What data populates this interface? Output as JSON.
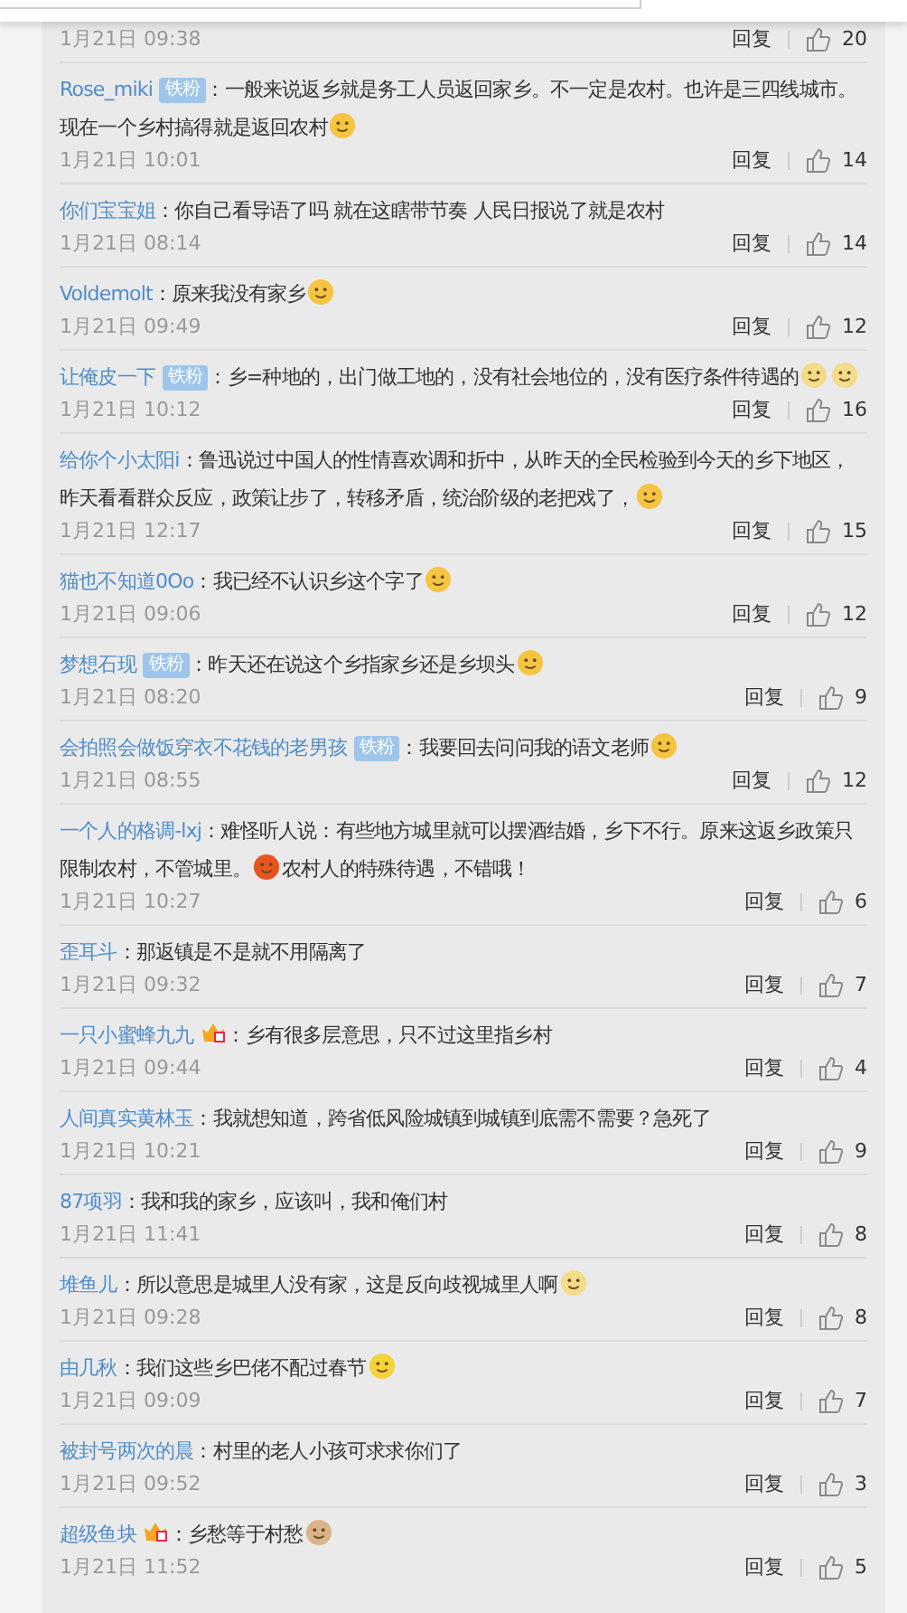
{
  "comments": [
    {
      "date": "1月21日 09:38",
      "reply": "回复",
      "likes": "20"
    },
    {
      "user": "Rose_miki",
      "badge": "铁粉",
      "content": [
        {
          "kind": "text",
          "text": "：一般来说返乡就是务工人员返回家乡。不一定是农村。也许是三四线城市。现在一个乡村搞得就是返回农村"
        },
        {
          "kind": "emoji",
          "color": "#f5c542"
        }
      ],
      "date": "1月21日 10:01",
      "reply": "回复",
      "likes": "14"
    },
    {
      "user": "你们宝宝姐",
      "content": [
        {
          "kind": "text",
          "text": "：你自己看导语了吗 就在这瞎带节奏 人民日报说了就是农村"
        }
      ],
      "date": "1月21日 08:14",
      "reply": "回复",
      "likes": "14"
    },
    {
      "user": "Voldemolt",
      "content": [
        {
          "kind": "text",
          "text": "：原来我没有家乡"
        },
        {
          "kind": "emoji",
          "color": "#f5c542"
        }
      ],
      "date": "1月21日 09:49",
      "reply": "回复",
      "likes": "12"
    },
    {
      "user": "让俺皮一下",
      "badge": "铁粉",
      "content": [
        {
          "kind": "text",
          "text": "：乡=种地的，出门做工地的，没有社会地位的，没有医疗条件待遇的"
        },
        {
          "kind": "emoji",
          "color": "#f3dc8a"
        },
        {
          "kind": "emoji",
          "color": "#f3dc8a"
        }
      ],
      "date": "1月21日 10:12",
      "reply": "回复",
      "likes": "16"
    },
    {
      "user": "给你个小太阳i",
      "content": [
        {
          "kind": "text",
          "text": "：鲁迅说过中国人的性情喜欢调和折中，从昨天的全民检验到今天的乡下地区，昨天看看群众反应，政策让步了，转移矛盾，统治阶级的老把戏了，"
        },
        {
          "kind": "emoji",
          "color": "#f5c542"
        }
      ],
      "date": "1月21日 12:17",
      "reply": "回复",
      "likes": "15"
    },
    {
      "user": "猫也不知道0Oo",
      "content": [
        {
          "kind": "text",
          "text": "：我已经不认识乡这个字了"
        },
        {
          "kind": "emoji",
          "color": "#f5c542"
        }
      ],
      "date": "1月21日 09:06",
      "reply": "回复",
      "likes": "12"
    },
    {
      "user": "梦想石现",
      "badge": "铁粉",
      "content": [
        {
          "kind": "text",
          "text": "：昨天还在说这个乡指家乡还是乡坝头"
        },
        {
          "kind": "emoji",
          "color": "#f5c542"
        }
      ],
      "date": "1月21日 08:20",
      "reply": "回复",
      "likes": "9"
    },
    {
      "user": "会拍照会做饭穿衣不花钱的老男孩",
      "badge": "铁粉",
      "content": [
        {
          "kind": "text",
          "text": "：我要回去问问我的语文老师"
        },
        {
          "kind": "emoji",
          "color": "#f5c542"
        }
      ],
      "date": "1月21日 08:55",
      "reply": "回复",
      "likes": "12"
    },
    {
      "user": "一个人的格调-lxj",
      "content": [
        {
          "kind": "text",
          "text": "：难怪听人说：有些地方城里就可以摆酒结婚，乡下不行。原来这返乡政策只限制农村，不管城里。"
        },
        {
          "kind": "emoji",
          "color": "#e8541e"
        },
        {
          "kind": "text",
          "text": "农村人的特殊待遇，不错哦！"
        }
      ],
      "date": "1月21日 10:27",
      "reply": "回复",
      "likes": "6"
    },
    {
      "user": "歪耳斗",
      "content": [
        {
          "kind": "text",
          "text": "：那返镇是不是就不用隔离了"
        }
      ],
      "date": "1月21日 09:32",
      "reply": "回复",
      "likes": "7"
    },
    {
      "user": "一只小蜜蜂九九",
      "vip": true,
      "content": [
        {
          "kind": "text",
          "text": "：乡有很多层意思，只不过这里指乡村"
        }
      ],
      "date": "1月21日 09:44",
      "reply": "回复",
      "likes": "4"
    },
    {
      "user": "人间真实黄林玉",
      "content": [
        {
          "kind": "text",
          "text": "：我就想知道，跨省低风险城镇到城镇到底需不需要？急死了"
        }
      ],
      "date": "1月21日 10:21",
      "reply": "回复",
      "likes": "9"
    },
    {
      "user": "87项羽",
      "content": [
        {
          "kind": "text",
          "text": "：我和我的家乡，应该叫，我和俺们村"
        }
      ],
      "date": "1月21日 11:41",
      "reply": "回复",
      "likes": "8"
    },
    {
      "user": "堆鱼儿",
      "content": [
        {
          "kind": "text",
          "text": "：所以意思是城里人没有家，这是反向歧视城里人啊"
        },
        {
          "kind": "emoji",
          "color": "#f3dc8a"
        }
      ],
      "date": "1月21日 09:28",
      "reply": "回复",
      "likes": "8"
    },
    {
      "user": "由几秋",
      "content": [
        {
          "kind": "text",
          "text": "：我们这些乡巴佬不配过春节"
        },
        {
          "kind": "emoji",
          "color": "#f5d33a"
        }
      ],
      "date": "1月21日 09:09",
      "reply": "回复",
      "likes": "7"
    },
    {
      "user": "被封号两次的晨",
      "content": [
        {
          "kind": "text",
          "text": "：村里的老人小孩可求求你们了"
        }
      ],
      "date": "1月21日 09:52",
      "reply": "回复",
      "likes": "3"
    },
    {
      "user": "超级鱼块",
      "vip": true,
      "content": [
        {
          "kind": "text",
          "text": "：乡愁等于村愁"
        },
        {
          "kind": "emoji",
          "color": "#d9b48a"
        }
      ],
      "date": "1月21日 11:52",
      "reply": "回复",
      "likes": "5"
    }
  ]
}
